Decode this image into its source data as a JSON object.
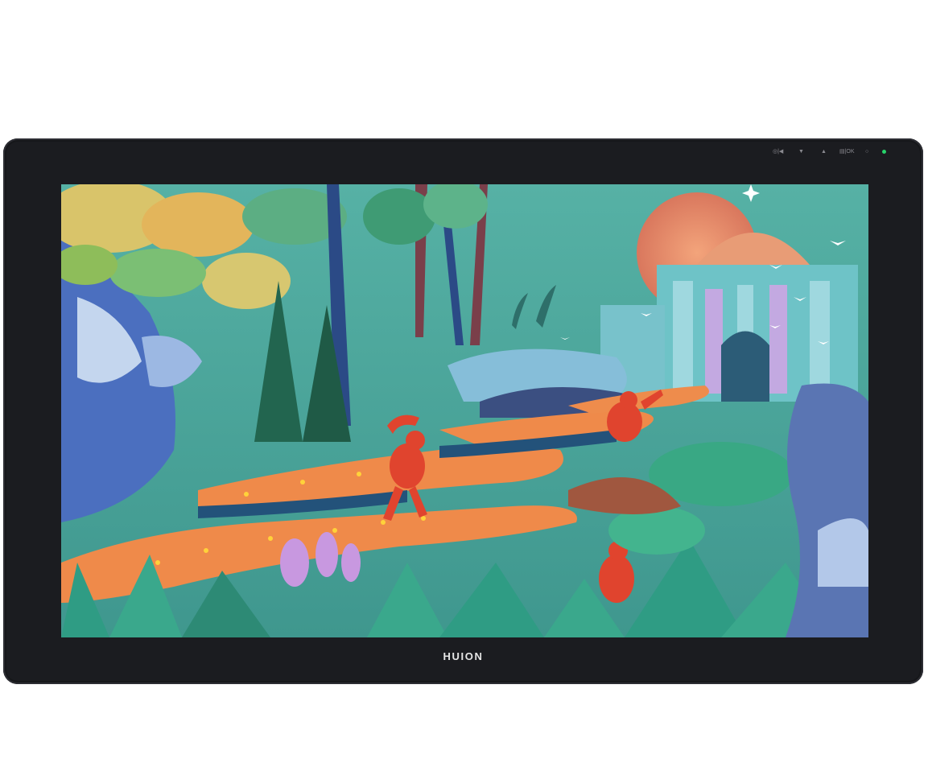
{
  "device": {
    "brand": "HUION",
    "controls": [
      {
        "name": "menu-back-button",
        "label": "◎|◀"
      },
      {
        "name": "down-button",
        "label": "▼"
      },
      {
        "name": "up-button",
        "label": "▲"
      },
      {
        "name": "input-ok-button",
        "label": "▤|OK"
      },
      {
        "name": "power-button",
        "label": "○"
      }
    ],
    "power_led_color": "#27d36a"
  }
}
